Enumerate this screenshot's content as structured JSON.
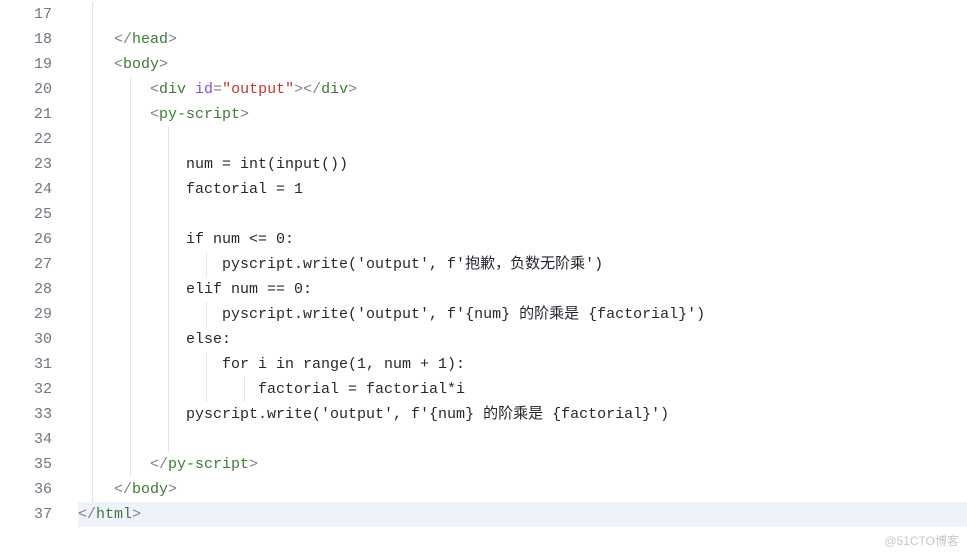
{
  "lines": [
    {
      "num": 17,
      "guides": [
        1
      ],
      "tokens": []
    },
    {
      "num": 18,
      "guides": [
        1
      ],
      "tokens": [
        {
          "t": "    ",
          "c": "txt"
        },
        {
          "t": "</",
          "c": "punct"
        },
        {
          "t": "head",
          "c": "tag"
        },
        {
          "t": ">",
          "c": "punct"
        }
      ]
    },
    {
      "num": 19,
      "guides": [
        1
      ],
      "tokens": [
        {
          "t": "    ",
          "c": "txt"
        },
        {
          "t": "<",
          "c": "punct"
        },
        {
          "t": "body",
          "c": "tag"
        },
        {
          "t": ">",
          "c": "punct"
        }
      ]
    },
    {
      "num": 20,
      "guides": [
        1,
        2
      ],
      "tokens": [
        {
          "t": "        ",
          "c": "txt"
        },
        {
          "t": "<",
          "c": "punct"
        },
        {
          "t": "div ",
          "c": "tag"
        },
        {
          "t": "id",
          "c": "attr"
        },
        {
          "t": "=",
          "c": "punct"
        },
        {
          "t": "\"output\"",
          "c": "str"
        },
        {
          "t": "></",
          "c": "punct"
        },
        {
          "t": "div",
          "c": "tag"
        },
        {
          "t": ">",
          "c": "punct"
        }
      ]
    },
    {
      "num": 21,
      "guides": [
        1,
        2
      ],
      "tokens": [
        {
          "t": "        ",
          "c": "txt"
        },
        {
          "t": "<",
          "c": "punct"
        },
        {
          "t": "py-script",
          "c": "tag"
        },
        {
          "t": ">",
          "c": "punct"
        }
      ]
    },
    {
      "num": 22,
      "guides": [
        1,
        2,
        3
      ],
      "tokens": []
    },
    {
      "num": 23,
      "guides": [
        1,
        2,
        3
      ],
      "tokens": [
        {
          "t": "            num = int(input())",
          "c": "txt"
        }
      ]
    },
    {
      "num": 24,
      "guides": [
        1,
        2,
        3
      ],
      "tokens": [
        {
          "t": "            factorial = 1",
          "c": "txt"
        }
      ]
    },
    {
      "num": 25,
      "guides": [
        1,
        2,
        3
      ],
      "tokens": []
    },
    {
      "num": 26,
      "guides": [
        1,
        2,
        3
      ],
      "tokens": [
        {
          "t": "            if num <= 0:",
          "c": "txt"
        }
      ]
    },
    {
      "num": 27,
      "guides": [
        1,
        2,
        3,
        4
      ],
      "tokens": [
        {
          "t": "                pyscript.write('output', f'抱歉，负数无阶乘')",
          "c": "txt"
        }
      ]
    },
    {
      "num": 28,
      "guides": [
        1,
        2,
        3
      ],
      "tokens": [
        {
          "t": "            elif num == 0:",
          "c": "txt"
        }
      ]
    },
    {
      "num": 29,
      "guides": [
        1,
        2,
        3,
        4
      ],
      "tokens": [
        {
          "t": "                pyscript.write('output', f'{num} 的阶乘是 {factorial}')",
          "c": "txt"
        }
      ]
    },
    {
      "num": 30,
      "guides": [
        1,
        2,
        3
      ],
      "tokens": [
        {
          "t": "            else:",
          "c": "txt"
        }
      ]
    },
    {
      "num": 31,
      "guides": [
        1,
        2,
        3,
        4
      ],
      "tokens": [
        {
          "t": "                for i in range(1, num + 1):",
          "c": "txt"
        }
      ]
    },
    {
      "num": 32,
      "guides": [
        1,
        2,
        3,
        4,
        5
      ],
      "tokens": [
        {
          "t": "                    factorial = factorial*i",
          "c": "txt"
        }
      ]
    },
    {
      "num": 33,
      "guides": [
        1,
        2,
        3
      ],
      "tokens": [
        {
          "t": "            pyscript.write('output', f'{num} 的阶乘是 {factorial}')",
          "c": "txt"
        }
      ]
    },
    {
      "num": 34,
      "guides": [
        1,
        2,
        3
      ],
      "tokens": []
    },
    {
      "num": 35,
      "guides": [
        1,
        2
      ],
      "tokens": [
        {
          "t": "        ",
          "c": "txt"
        },
        {
          "t": "</",
          "c": "punct"
        },
        {
          "t": "py-script",
          "c": "tag"
        },
        {
          "t": ">",
          "c": "punct"
        }
      ]
    },
    {
      "num": 36,
      "guides": [
        1
      ],
      "tokens": [
        {
          "t": "    ",
          "c": "txt"
        },
        {
          "t": "</",
          "c": "punct"
        },
        {
          "t": "body",
          "c": "tag"
        },
        {
          "t": ">",
          "c": "punct"
        }
      ]
    },
    {
      "num": 37,
      "guides": [],
      "hl": true,
      "tokens": [
        {
          "t": "</",
          "c": "punct"
        },
        {
          "t": "html",
          "c": "tag"
        },
        {
          "t": ">",
          "c": "punct"
        }
      ]
    }
  ],
  "watermark": "@51CTO博客"
}
